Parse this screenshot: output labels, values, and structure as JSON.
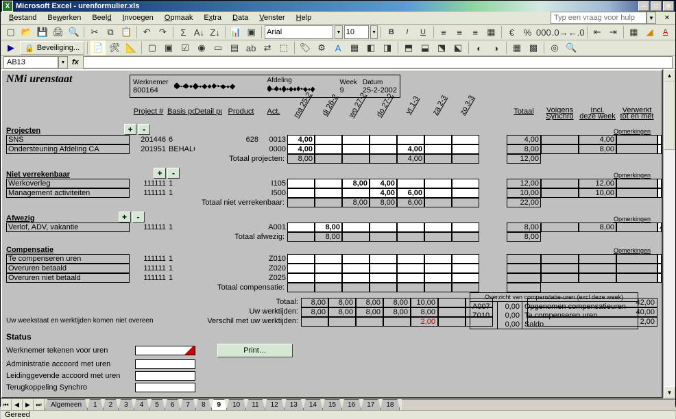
{
  "title": "Microsoft Excel - urenformulier.xls",
  "menu": [
    "Bestand",
    "Bewerken",
    "Beeld",
    "Invoegen",
    "Opmaak",
    "Extra",
    "Data",
    "Venster",
    "Help"
  ],
  "askHelp": "Typ een vraag voor hulp",
  "securityBtn": "Beveiliging...",
  "nameBox": "AB13",
  "font": "Arial",
  "fontSize": "10",
  "sheetTitle": "NMi urenstaat",
  "empLabels": {
    "werknemer": "Werknemer",
    "afdeling": "Afdeling",
    "week": "Week",
    "datum": "Datum"
  },
  "emp": {
    "id": "800164",
    "week": "9",
    "datum": "25-2-2002"
  },
  "cols": [
    "",
    "Project #",
    "Basis post",
    "Detail post",
    "Product",
    "Act.",
    "ma 25-2",
    "di 26-2",
    "wo 27-2",
    "do 27-2",
    "vr 1-3",
    "za 2-3",
    "zo 3-3",
    "",
    "Totaal",
    "Volgens Synchro",
    "Incl. deze week",
    "Verwerkt tot en met",
    "Opmerkingen"
  ],
  "sections": {
    "projecten": {
      "label": "Projecten",
      "totLabel": "Totaal projecten:",
      "rows": [
        {
          "name": "SNS",
          "proj": "201446",
          "basis": "6",
          "detail": "",
          "product": "628",
          "act": "0013",
          "d": [
            "4,00",
            "",
            "",
            "",
            "",
            "",
            ""
          ],
          "tot": "4,00",
          "sync": "",
          "incl": "4,00",
          "verw": ""
        },
        {
          "name": "Ondersteuning Afdeling CA",
          "proj": "201951",
          "basis": "BEHALG",
          "detail": "",
          "product": "",
          "act": "0000",
          "d": [
            "4,00",
            "",
            "",
            "",
            "4,00",
            "",
            ""
          ],
          "tot": "8,00",
          "sync": "",
          "incl": "8,00",
          "verw": ""
        }
      ],
      "tot": [
        "8,00",
        "",
        "",
        "",
        "4,00",
        "",
        "",
        ""
      ],
      "totSum": "12,00"
    },
    "niet": {
      "label": "Niet verrekenbaar",
      "totLabel": "Totaal niet verrekenbaar:",
      "rows": [
        {
          "name": "Werkoverleg",
          "proj": "111111",
          "basis": "1",
          "detail": "",
          "product": "",
          "act": "I105",
          "d": [
            "",
            "",
            "8,00",
            "4,00",
            "",
            "",
            ""
          ],
          "tot": "12,00",
          "sync": "",
          "incl": "12,00",
          "verw": ""
        },
        {
          "name": "Management activiteiten",
          "proj": "111111",
          "basis": "1",
          "detail": "",
          "product": "",
          "act": "I500",
          "d": [
            "",
            "",
            "",
            "4,00",
            "6,00",
            "",
            ""
          ],
          "tot": "10,00",
          "sync": "",
          "incl": "10,00",
          "verw": ""
        }
      ],
      "tot": [
        "",
        "",
        "8,00",
        "8,00",
        "6,00",
        "",
        "",
        ""
      ],
      "totSum": "22,00"
    },
    "afwezig": {
      "label": "Afwezig",
      "totLabel": "Totaal afwezig:",
      "rows": [
        {
          "name": "Verlof, ADV, vakantie",
          "proj": "111111",
          "basis": "1",
          "detail": "",
          "product": "",
          "act": "A001",
          "d": [
            "",
            "8,00",
            "",
            "",
            "",
            "",
            ""
          ],
          "tot": "8,00",
          "sync": "",
          "incl": "8,00",
          "verw": "",
          "opm": "ADV"
        }
      ],
      "tot": [
        "",
        "8,00",
        "",
        "",
        "",
        "",
        "",
        ""
      ],
      "totSum": "8,00"
    },
    "comp": {
      "label": "Compensatie",
      "totLabel": "Totaal compensatie:",
      "rows": [
        {
          "name": "Te compenseren uren",
          "proj": "111111",
          "basis": "1",
          "detail": "",
          "product": "",
          "act": "Z010",
          "d": [
            "",
            "",
            "",
            "",
            "",
            "",
            ""
          ],
          "tot": "",
          "sync": "",
          "incl": "",
          "verw": ""
        },
        {
          "name": "Overuren betaald",
          "proj": "111111",
          "basis": "1",
          "detail": "",
          "product": "",
          "act": "Z020",
          "d": [
            "",
            "",
            "",
            "",
            "",
            "",
            ""
          ],
          "tot": "",
          "sync": "",
          "incl": "",
          "verw": ""
        },
        {
          "name": "Overuren niet betaald",
          "proj": "111111",
          "basis": "1",
          "detail": "",
          "product": "",
          "act": "Z025",
          "d": [
            "",
            "",
            "",
            "",
            "",
            "",
            ""
          ],
          "tot": "",
          "sync": "",
          "incl": "",
          "verw": ""
        }
      ],
      "tot": [
        "",
        "",
        "",
        "",
        "",
        "",
        "",
        ""
      ],
      "totSum": ""
    }
  },
  "summary": {
    "totaal": {
      "lbl": "Totaal:",
      "d": [
        "8,00",
        "8,00",
        "8,00",
        "8,00",
        "10,00",
        "",
        ""
      ],
      "sum": "42,00"
    },
    "werkt": {
      "lbl": "Uw werktijden:",
      "d": [
        "8,00",
        "8,00",
        "8,00",
        "8,00",
        "8,00",
        "",
        ""
      ],
      "sum": "40,00"
    },
    "verschil": {
      "lbl": "Verschil met uw werktijden:",
      "d": [
        "",
        "",
        "",
        "",
        "2,00",
        "",
        ""
      ],
      "sum": "2,00"
    }
  },
  "warnLine": "Uw weekstaat en werktijden komen niet overeen",
  "status": {
    "title": "Status",
    "rows": [
      "Werknemer tekenen voor uren",
      "Administratie accoord met uren",
      "Leidinggevende accoord met uren",
      "Terugkoppeling Synchro"
    ]
  },
  "printBtn": "Print…",
  "compOverview": {
    "title": "Overzicht van compenstatie-uren (excl deze week)",
    "rows": [
      {
        "c": "A007",
        "v": "0,00",
        "t": "Opgenomen compensatieuren"
      },
      {
        "c": "Z010",
        "v": "0,00",
        "t": "Te compenseren uren"
      },
      {
        "c": "",
        "v": "0,00",
        "t": "Saldo"
      }
    ]
  },
  "tabs": [
    "Algemeen",
    "1",
    "2",
    "3",
    "4",
    "5",
    "6",
    "7",
    "8",
    "9",
    "10",
    "11",
    "12",
    "13",
    "14",
    "15",
    "16",
    "17",
    "18"
  ],
  "activeTab": "9",
  "statusBar": "Gereed",
  "opmHeader": "Opmerkingen"
}
